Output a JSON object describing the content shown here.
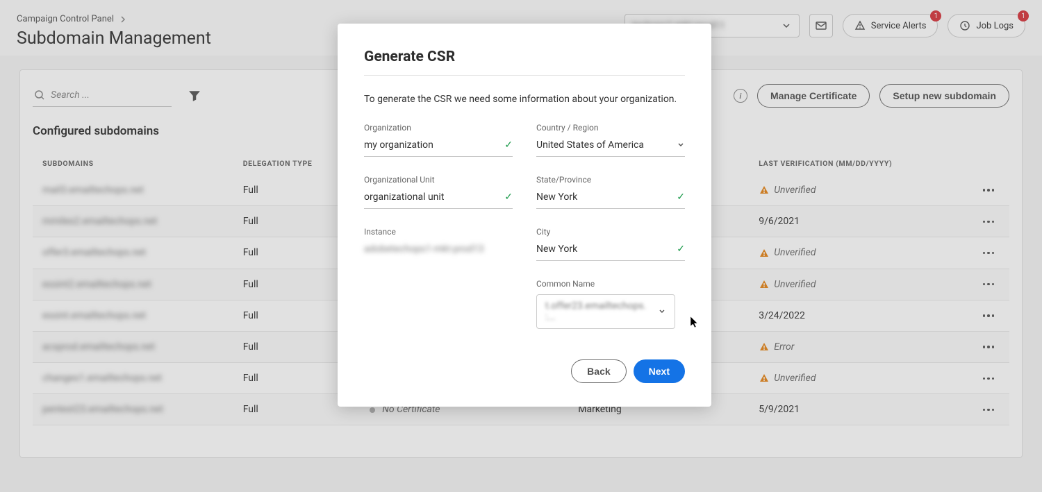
{
  "breadcrumb": [
    "Campaign Control Panel"
  ],
  "page_title": "Subdomain Management",
  "header": {
    "instance_placeholder": "techops1-mkt-prod11",
    "service_alerts_label": "Service Alerts",
    "service_alerts_badge": "1",
    "job_logs_label": "Job Logs",
    "job_logs_badge": "1"
  },
  "toolbar": {
    "search_placeholder": "Search ...",
    "manage_cert_label": "Manage Certificate",
    "setup_subdomain_label": "Setup new subdomain"
  },
  "section_title": "Configured subdomains",
  "columns": {
    "subdomains": "SUBDOMAINS",
    "delegation": "DELEGATION TYPE",
    "last_verification": "LAST VERIFICATION (MM/DD/YYYY)"
  },
  "rows": [
    {
      "sub": "mail3.emailtechops.net",
      "delegation": "Full",
      "verify": "Unverified",
      "verify_warn": true
    },
    {
      "sub": "mmiles2.emailtechops.net",
      "delegation": "Full",
      "verify": "9/6/2021",
      "verify_warn": false
    },
    {
      "sub": "offer3.emailtechops.net",
      "delegation": "Full",
      "verify": "Unverified",
      "verify_warn": true
    },
    {
      "sub": "essint2.emailtechops.net",
      "delegation": "Full",
      "verify": "Unverified",
      "verify_warn": true
    },
    {
      "sub": "essint.emailtechops.net",
      "delegation": "Full",
      "verify": "3/24/2022",
      "verify_warn": false
    },
    {
      "sub": "acsprod.emailtechops.net",
      "delegation": "Full",
      "verify": "Error",
      "verify_warn": true
    },
    {
      "sub": "changes1.emailtechops.net",
      "delegation": "Full",
      "verify": "Unverified",
      "verify_warn": true
    },
    {
      "sub": "pentest23.emailtechops.net",
      "delegation": "Full",
      "verify": "5/9/2021",
      "verify_warn": false,
      "no_cert": "No Certificate",
      "cat": "Marketing"
    }
  ],
  "modal": {
    "title": "Generate CSR",
    "desc": "To generate the CSR we need some information about your organization.",
    "fields": {
      "org_label": "Organization",
      "org_value": "my organization",
      "country_label": "Country / Region",
      "country_value": "United States of America",
      "ou_label": "Organizational Unit",
      "ou_value": "organizational unit",
      "state_label": "State/Province",
      "state_value": "New York",
      "instance_label": "Instance",
      "instance_value": "adobetechops1-mkt-prod13",
      "city_label": "City",
      "city_value": "New York",
      "common_name_label": "Common Name",
      "common_name_value": "t.offer23.emailtechops. :..."
    },
    "back_label": "Back",
    "next_label": "Next"
  }
}
